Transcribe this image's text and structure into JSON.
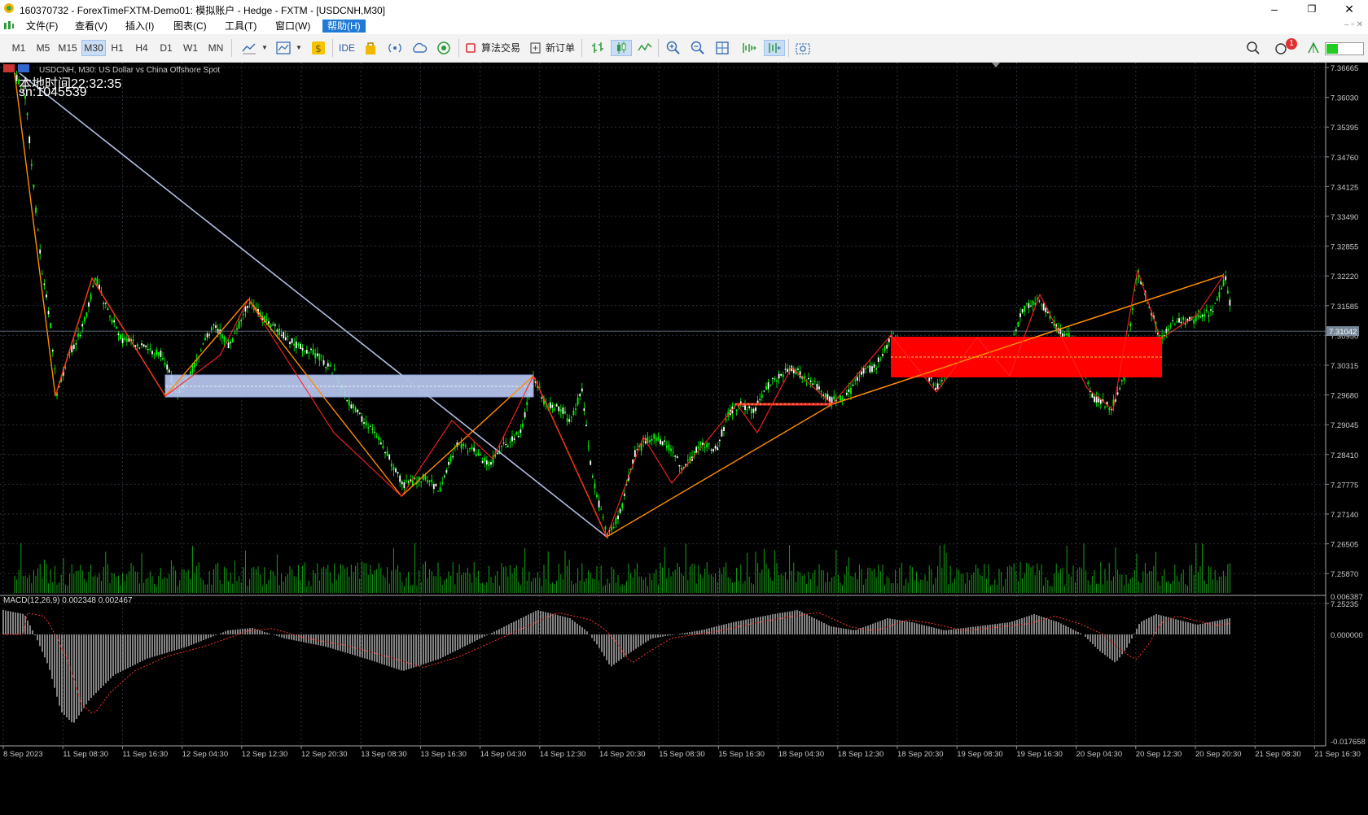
{
  "window": {
    "title": "160370732 - ForexTimeFXTM-Demo01: 模拟账户 - Hedge - FXTM - [USDCNH,M30]",
    "minimize": "–",
    "maximize": "❐",
    "close": "✕"
  },
  "menu": {
    "items": [
      "文件(F)",
      "查看(V)",
      "插入(I)",
      "图表(C)",
      "工具(T)",
      "窗口(W)",
      "帮助(H)"
    ],
    "active_index": 6,
    "mdi_controls": "– ▫ ✕"
  },
  "toolbar": {
    "timeframes": [
      "M1",
      "M5",
      "M15",
      "M30",
      "H1",
      "H4",
      "D1",
      "W1",
      "MN"
    ],
    "selected_timeframe": "M30",
    "ide_label": "IDE",
    "algo_trading_label": "算法交易",
    "new_order_label": "新订单",
    "notification_count": "1",
    "icons": [
      "line-studies-icon",
      "chart-type-icon",
      "dollar-icon",
      "bag-icon",
      "signal-icon",
      "cloud-icon",
      "vps-icon",
      "algo-stop-icon",
      "new-order-icon",
      "bar-chart-icon",
      "candlestick-icon",
      "line-chart-icon",
      "zoom-in-icon",
      "zoom-out-icon",
      "grid-icon",
      "autoscroll-icon",
      "chart-shift-icon",
      "screenshot-icon",
      "search-icon",
      "notification-icon",
      "signal-strength-icon"
    ]
  },
  "chart": {
    "symbol_desc": "USDCNH, M30:  US Dollar vs China Offshore Spot",
    "local_time_label": "本地时间",
    "local_time": "22:32:35",
    "sn_label": "sn:1045539",
    "current_price": "7.31042",
    "price_ticks": [
      "7.36665",
      "7.36030",
      "7.35395",
      "7.34760",
      "7.34125",
      "7.33490",
      "7.32855",
      "7.32220",
      "7.31585",
      "7.30950",
      "7.30315",
      "7.29680",
      "7.29045",
      "7.28410",
      "7.27775",
      "7.27140",
      "7.26505",
      "7.25870",
      "7.25235"
    ],
    "macd_label": "MACD(12,26,9) 0.002348 0.002467",
    "macd_ticks": [
      "0.006387",
      "0.000000",
      "-0.017658"
    ],
    "time_ticks": [
      "8 Sep 2023",
      "11 Sep 08:30",
      "11 Sep 16:30",
      "12 Sep 04:30",
      "12 Sep 12:30",
      "12 Sep 20:30",
      "13 Sep 08:30",
      "13 Sep 16:30",
      "14 Sep 04:30",
      "14 Sep 12:30",
      "14 Sep 20:30",
      "15 Sep 08:30",
      "15 Sep 16:30",
      "18 Sep 04:30",
      "18 Sep 12:30",
      "18 Sep 20:30",
      "19 Sep 08:30",
      "19 Sep 16:30",
      "20 Sep 04:30",
      "20 Sep 12:30",
      "20 Sep 20:30",
      "21 Sep 08:30",
      "21 Sep 16:30"
    ],
    "colors": {
      "background": "#000000",
      "grid": "#2a2f3a",
      "candle_up": "#00ff00",
      "candle_down": "#ffffff",
      "zigzag_orange": "#ff8c00",
      "zigzag_red": "#ff2020",
      "trendline": "#b0bce0",
      "blue_zone": "#b8c8f0",
      "red_zone": "#ff0000",
      "volume": "#14a014",
      "macd_hist": "#c8c8c8",
      "macd_signal": "#ff3030"
    }
  }
}
